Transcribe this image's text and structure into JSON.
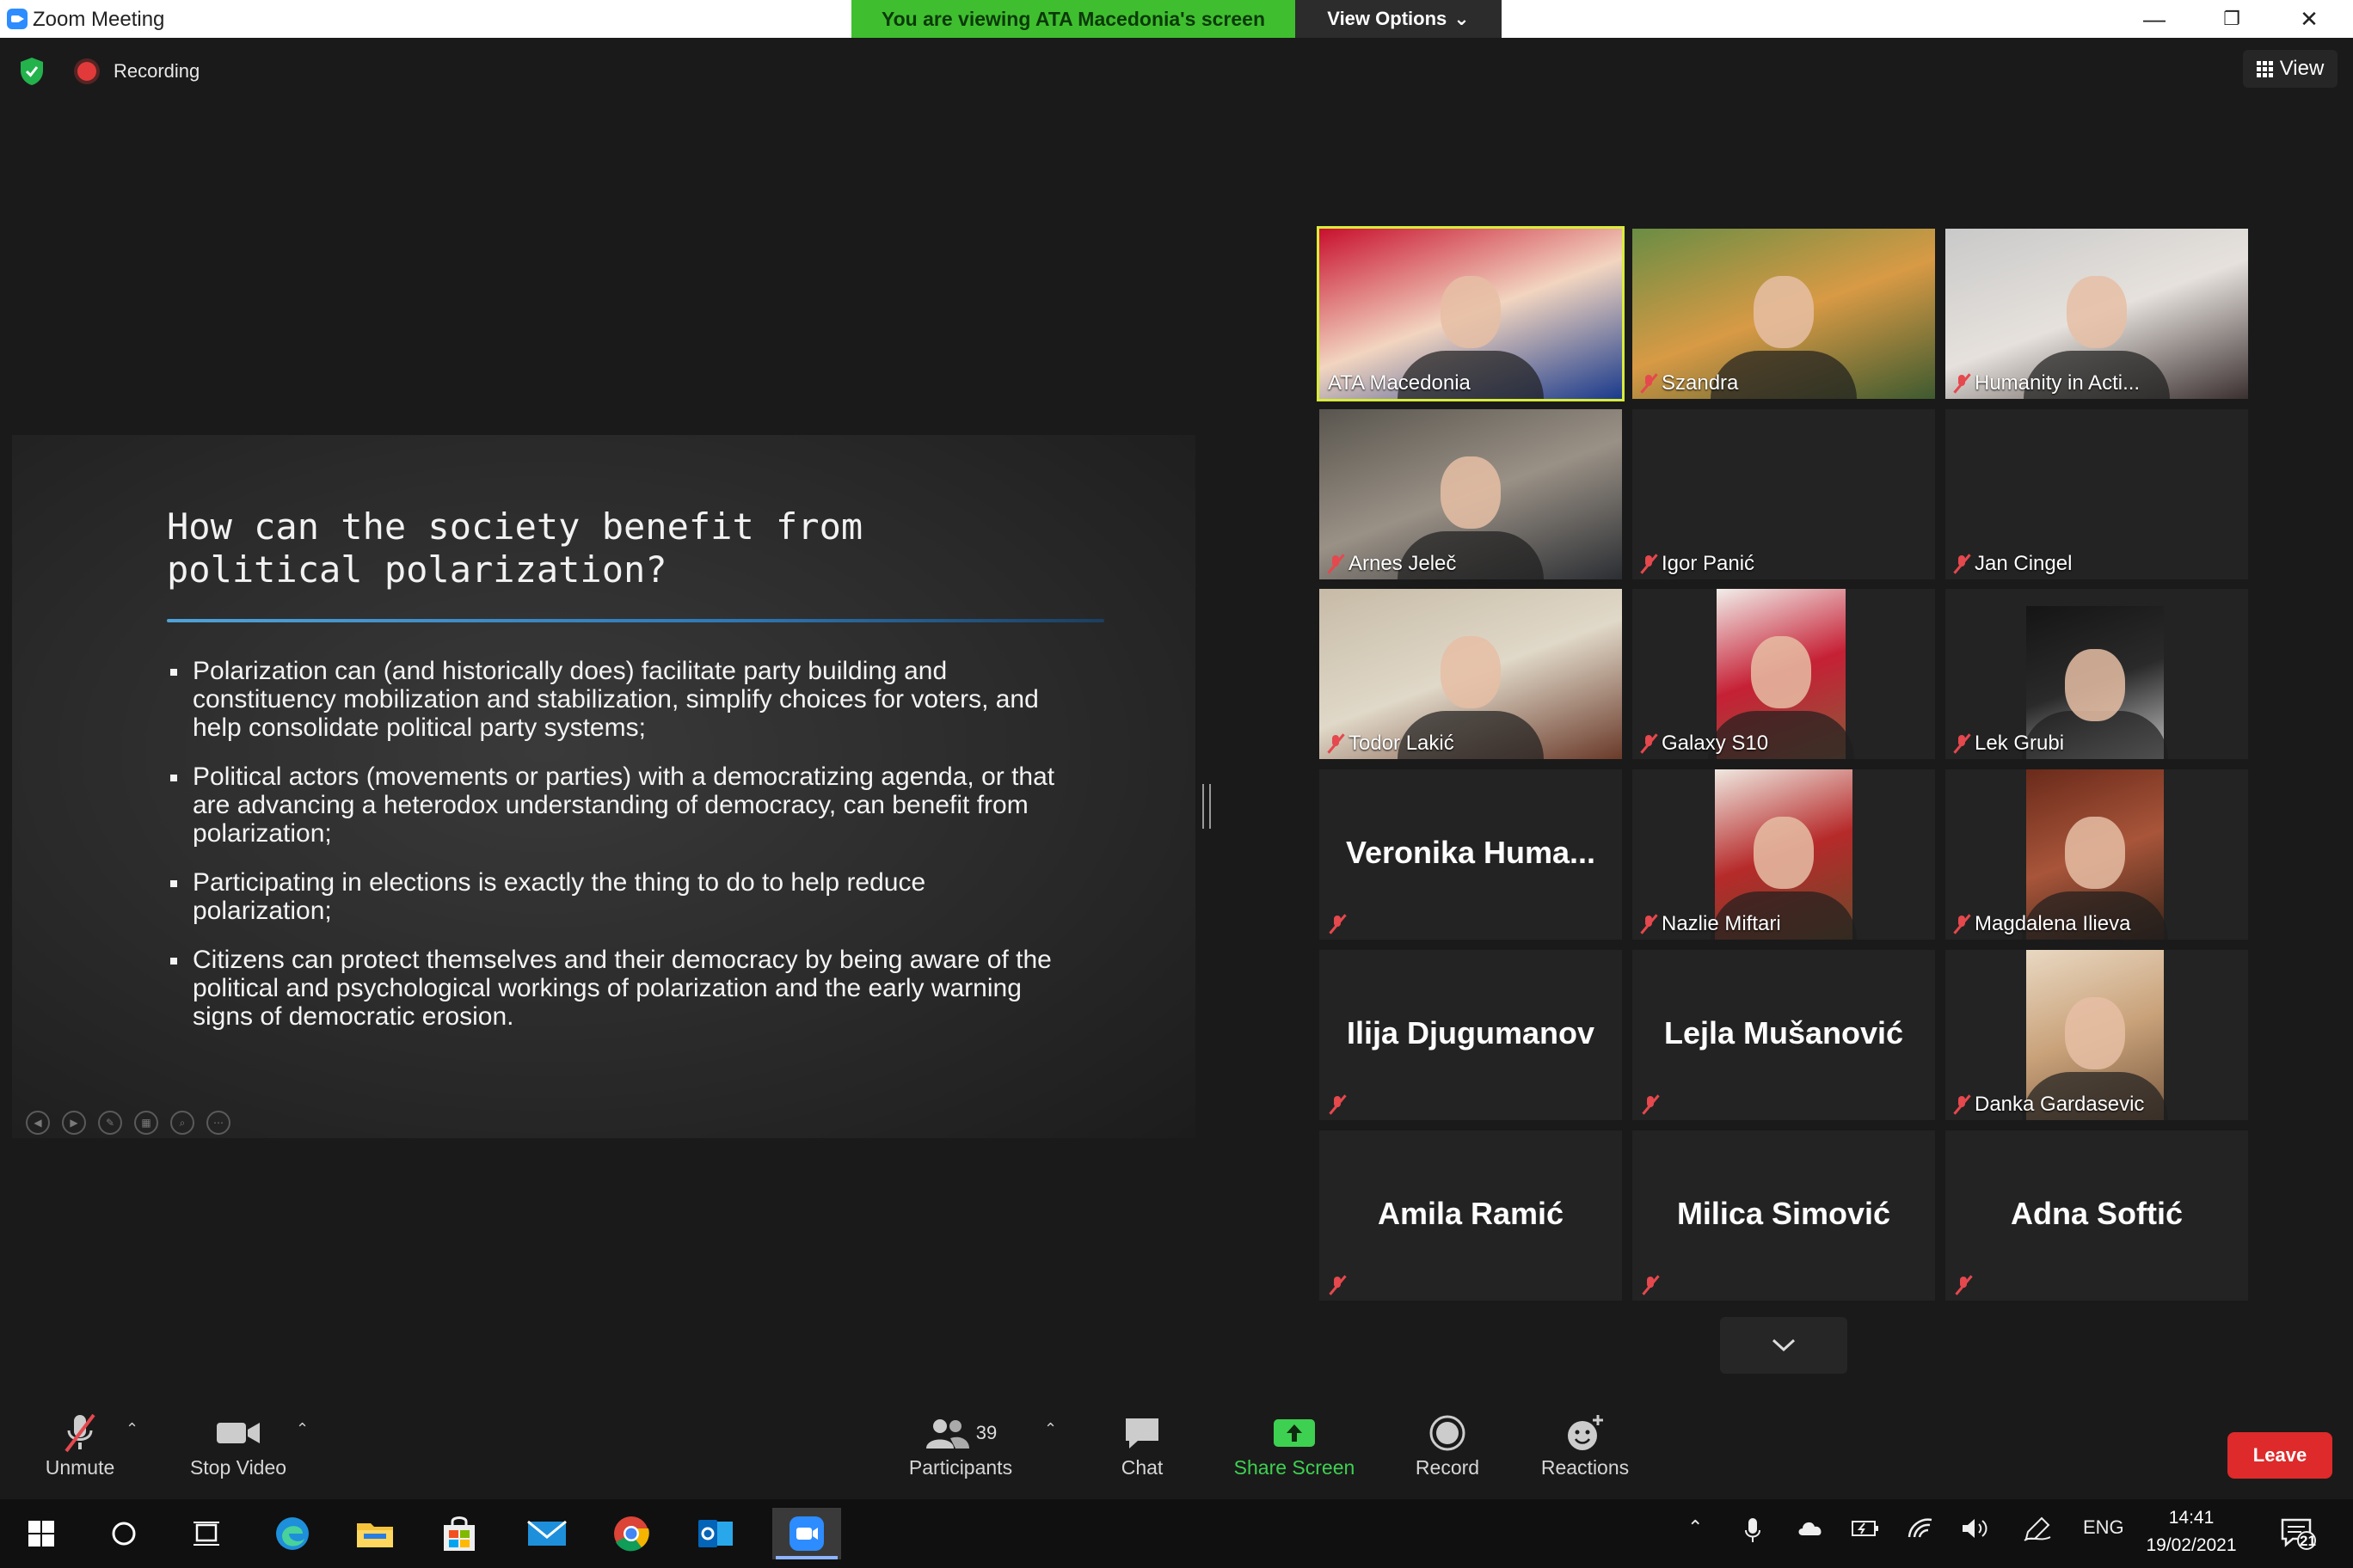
{
  "window": {
    "title": "Zoom Meeting"
  },
  "banner": {
    "viewing": "You are viewing ATA Macedonia's screen",
    "view_options": "View Options"
  },
  "meeting": {
    "recording": "Recording",
    "view": "View"
  },
  "slide": {
    "title": "How can the society benefit from\npolitical polarization?",
    "bullets": [
      "Polarization can (and historically does) facilitate party building and constituency mobilization and stabilization, simplify choices for voters, and help consolidate political party systems;",
      "Political actors (movements or parties) with a democratizing agenda, or that are advancing a heterodox understanding of democracy, can benefit from polarization;",
      "Participating in elections is exactly the thing to do to help reduce polarization;",
      "Citizens can protect themselves and their democracy by being aware of the political and psychological workings of polarization and the early warning signs of democratic erosion."
    ]
  },
  "participants": [
    {
      "name": "ATA Macedonia",
      "video": true,
      "active": true,
      "muted": false
    },
    {
      "name": "Szandra",
      "video": true,
      "muted": true
    },
    {
      "name": "Humanity in Acti...",
      "video": true,
      "muted": true
    },
    {
      "name": "Arnes Jeleč",
      "video": true,
      "muted": true
    },
    {
      "name": "Igor Panić",
      "video": false,
      "muted": true
    },
    {
      "name": "Jan Cingel",
      "video": false,
      "muted": true
    },
    {
      "name": "Todor Lakić",
      "video": true,
      "muted": true
    },
    {
      "name": "Galaxy S10",
      "video": true,
      "muted": true
    },
    {
      "name": "Lek Grubi",
      "video": true,
      "muted": true
    },
    {
      "name": "Veronika  Huma...",
      "video": false,
      "big": true,
      "muted": true
    },
    {
      "name": "Nazlie Miftari",
      "video": true,
      "muted": true
    },
    {
      "name": "Magdalena Ilieva",
      "video": true,
      "muted": true
    },
    {
      "name": "Ilija Djugumanov",
      "video": false,
      "big": true,
      "muted": true
    },
    {
      "name": "Lejla Mušanović",
      "video": false,
      "big": true,
      "muted": true
    },
    {
      "name": "Danka Gardasevic",
      "video": true,
      "muted": true
    },
    {
      "name": "Amila Ramić",
      "video": false,
      "big": true,
      "muted": true
    },
    {
      "name": "Milica Simović",
      "video": false,
      "big": true,
      "muted": true
    },
    {
      "name": "Adna Softić",
      "video": false,
      "big": true,
      "muted": true
    }
  ],
  "toolbar": {
    "unmute": "Unmute",
    "stop_video": "Stop Video",
    "participants": "Participants",
    "participants_count": "39",
    "chat": "Chat",
    "share_screen": "Share Screen",
    "record": "Record",
    "reactions": "Reactions",
    "leave": "Leave"
  },
  "taskbar": {
    "lang": "ENG",
    "time": "14:41",
    "date": "19/02/2021",
    "notifications": "21"
  },
  "colors": {
    "active_speaker": "#d9ec3a",
    "share_green": "#3ed051",
    "leave_red": "#de2a2a",
    "muted_red": "#e5484d"
  }
}
